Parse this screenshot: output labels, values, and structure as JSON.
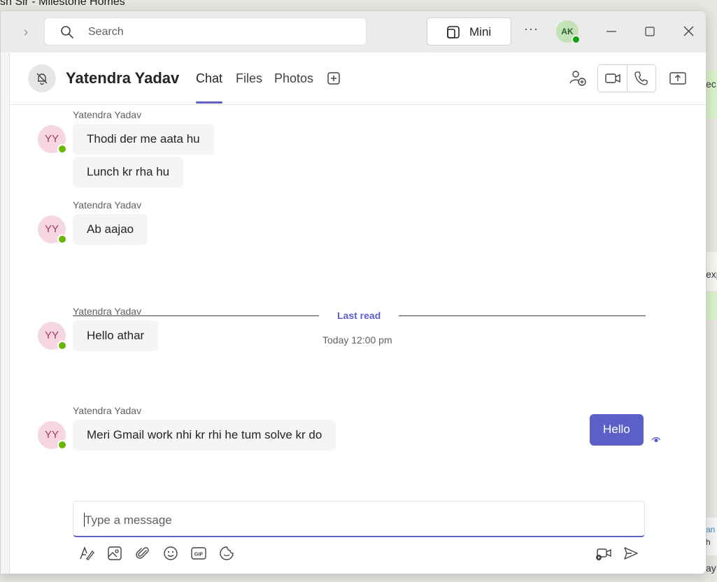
{
  "background": {
    "window_title_fragment": "sh Sir - Milestone Homes",
    "right_fragments": [
      "ec",
      "exp",
      "an",
      "h",
      "ay"
    ]
  },
  "titlebar": {
    "search_placeholder": "Search",
    "mini_label": "Mini",
    "more_label": "···",
    "user_initials": "AK"
  },
  "chat_header": {
    "contact_name": "Yatendra Yadav",
    "tabs": [
      {
        "label": "Chat",
        "active": true
      },
      {
        "label": "Files",
        "active": false
      },
      {
        "label": "Photos",
        "active": false
      }
    ]
  },
  "messages": {
    "groups": [
      {
        "sender": "Yatendra Yadav",
        "initials": "YY",
        "bubbles": [
          "Thodi der me aata hu",
          "Lunch kr rha hu"
        ]
      },
      {
        "sender": "Yatendra Yadav",
        "initials": "YY",
        "bubbles": [
          "Ab aajao"
        ]
      },
      {
        "sender": "Yatendra Yadav",
        "initials": "YY",
        "bubbles": [
          "Hello athar"
        ]
      },
      {
        "sender": "Yatendra Yadav",
        "initials": "YY",
        "bubbles": [
          "Meri Gmail work nhi kr rhi he tum solve kr do"
        ]
      }
    ],
    "last_read_label": "Last read",
    "timestamp": "Today 12:00 pm",
    "my_message": "Hello"
  },
  "compose": {
    "placeholder": "Type a message"
  },
  "colors": {
    "accent": "#5b5fc7",
    "presence_available": "#6bb700",
    "avatar_bg": "#f6d6e0"
  }
}
